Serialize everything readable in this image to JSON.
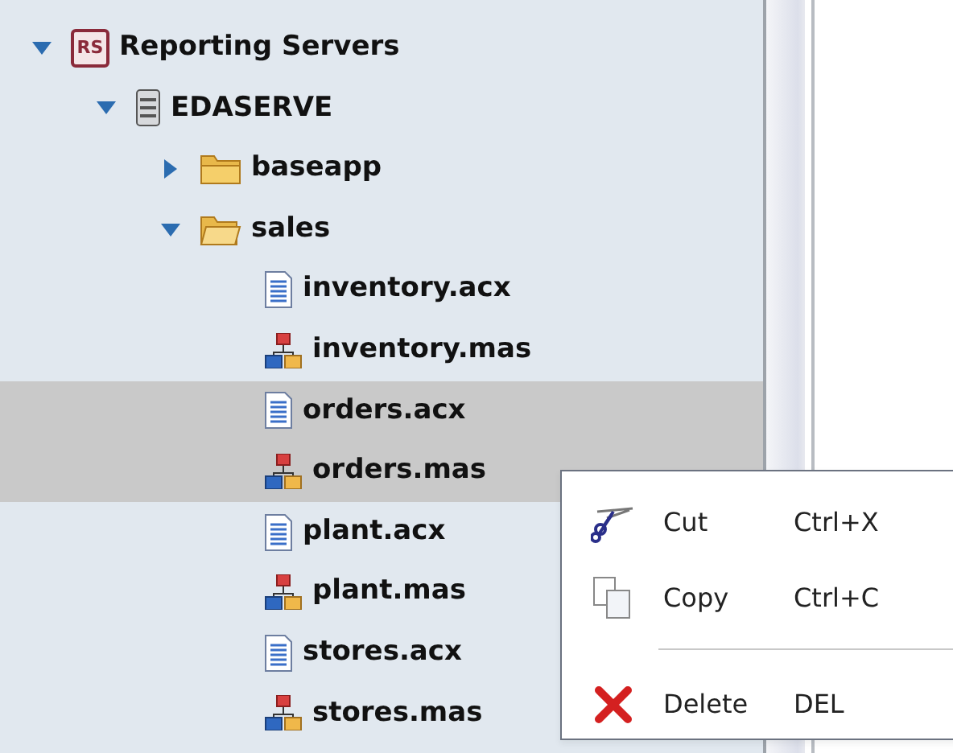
{
  "tree": [
    {
      "label": "Reporting Servers",
      "kind": "root",
      "badge": "RS",
      "expanded": true,
      "selected": false,
      "children": [
        {
          "label": "EDASERVE",
          "kind": "server",
          "expanded": true,
          "selected": false,
          "children": [
            {
              "label": "baseapp",
              "kind": "folder",
              "expanded": false,
              "selected": false
            },
            {
              "label": "sales",
              "kind": "folder",
              "expanded": true,
              "selected": false,
              "children": [
                {
                  "label": "inventory.acx",
                  "kind": "acx",
                  "selected": false
                },
                {
                  "label": "inventory.mas",
                  "kind": "mas",
                  "selected": false
                },
                {
                  "label": "orders.acx",
                  "kind": "acx",
                  "selected": true
                },
                {
                  "label": "orders.mas",
                  "kind": "mas",
                  "selected": true
                },
                {
                  "label": "plant.acx",
                  "kind": "acx",
                  "selected": false
                },
                {
                  "label": "plant.mas",
                  "kind": "mas",
                  "selected": false
                },
                {
                  "label": "stores.acx",
                  "kind": "acx",
                  "selected": false
                },
                {
                  "label": "stores.mas",
                  "kind": "mas",
                  "selected": false
                }
              ]
            }
          ]
        }
      ]
    }
  ],
  "context_menu": [
    {
      "kind": "cut",
      "label": "Cut",
      "shortcut": "Ctrl+X"
    },
    {
      "kind": "copy",
      "label": "Copy",
      "shortcut": "Ctrl+C"
    },
    {
      "kind": "separator"
    },
    {
      "kind": "delete",
      "label": "Delete",
      "shortcut": "DEL"
    }
  ]
}
